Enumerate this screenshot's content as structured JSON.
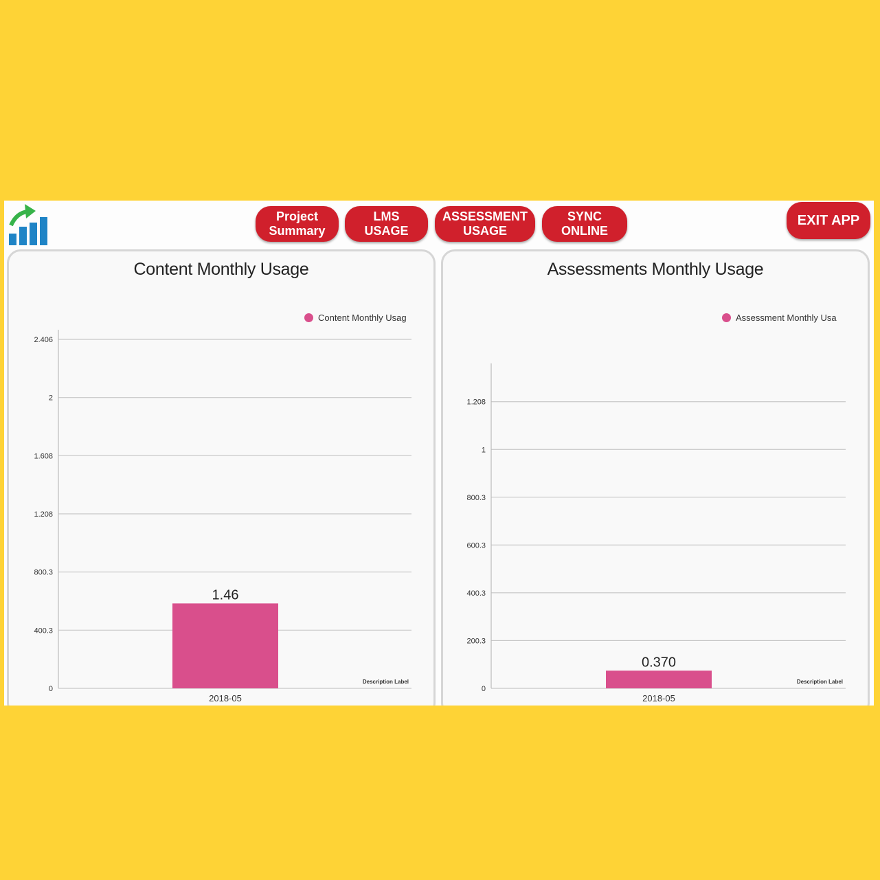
{
  "colors": {
    "background": "#fed336",
    "button": "#d0202c",
    "bar": "#d94f8c",
    "gridline": "#c8c8c8"
  },
  "header": {
    "logo_icon": "bar-chart-growth-arrow-icon",
    "nav": {
      "project_summary": "Project\nSummary",
      "lms_usage": "LMS\nUSAGE",
      "assessment_usage": "ASSESSMENT\nUSAGE",
      "sync_online": "SYNC\nONLINE"
    },
    "exit_label": "EXIT APP"
  },
  "panels": {
    "content": {
      "title": "Content Monthly Usage",
      "legend": "Content Monthly Usag"
    },
    "assessment": {
      "title": "Assessments Monthly Usage",
      "legend": "Assessment Monthly Usa"
    }
  },
  "chart_data": [
    {
      "type": "bar",
      "title": "Content Monthly Usage",
      "categories": [
        "2018-05"
      ],
      "series": [
        {
          "name": "Content Monthly Usag",
          "values": [
            1.46
          ]
        }
      ],
      "data_labels": [
        "1.46"
      ],
      "y_ticks": [
        "0",
        "400.3",
        "800.3",
        "1.208",
        "1.608",
        "2",
        "2.406"
      ],
      "ylim": [
        0,
        6
      ],
      "xlabel": "Description Label",
      "ylabel": "",
      "grid": true,
      "legend_position": "top-right"
    },
    {
      "type": "bar",
      "title": "Assessments Monthly Usage",
      "categories": [
        "2018-05"
      ],
      "series": [
        {
          "name": "Assessment Monthly Usa",
          "values": [
            0.37
          ]
        }
      ],
      "data_labels": [
        "0.370"
      ],
      "y_ticks": [
        "0",
        "200.3",
        "400.3",
        "600.3",
        "800.3",
        "1",
        "1.208"
      ],
      "ylim": [
        0,
        6.6
      ],
      "xlabel": "Description Label",
      "ylabel": "",
      "grid": true,
      "legend_position": "top-right"
    }
  ]
}
